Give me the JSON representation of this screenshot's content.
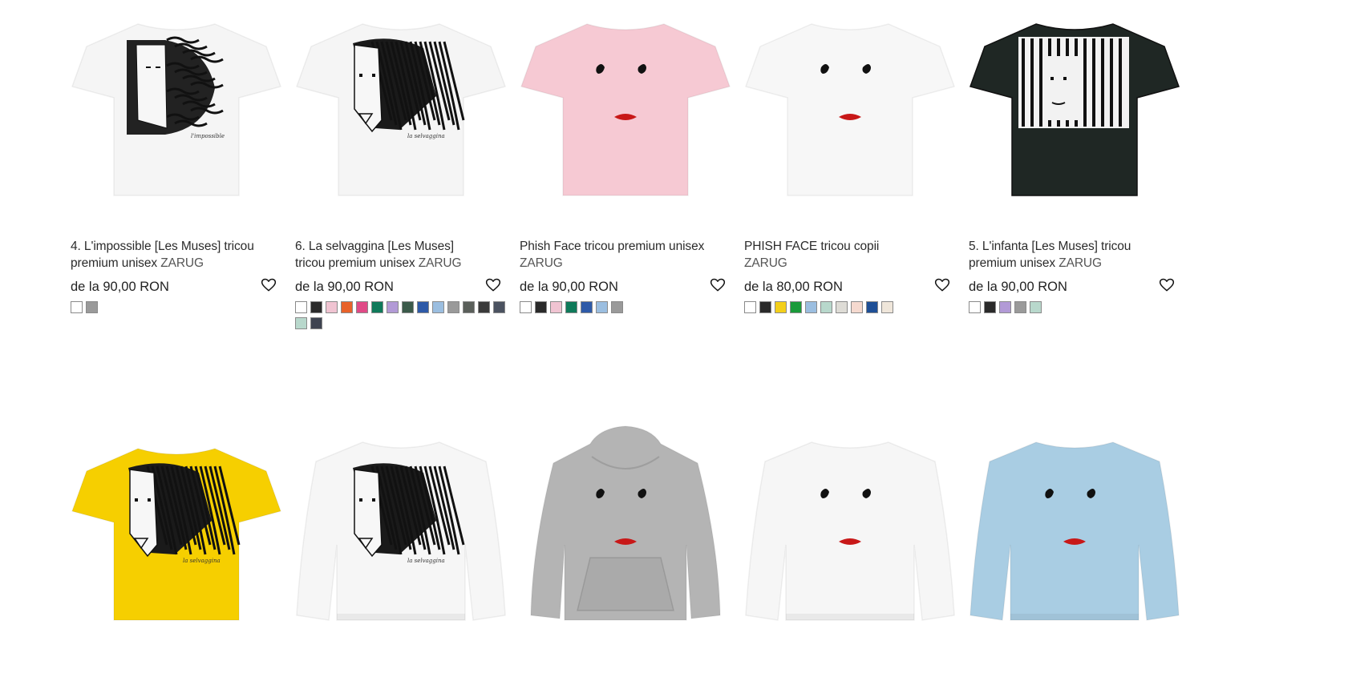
{
  "products": [
    {
      "title": "4. L'impossible [Les Muses] tricou premium unisex",
      "brand": "ZARUG",
      "price": "de la 90,00 RON",
      "garment": "tshirt",
      "color": "#f5f5f5",
      "design": "curly",
      "swatches": [
        "#ffffff",
        "#9a9a9a"
      ]
    },
    {
      "title": "6. La selvaggina [Les Muses] tricou premium unisex",
      "brand": "ZARUG",
      "price": "de la 90,00 RON",
      "garment": "tshirt",
      "color": "#f5f5f5",
      "design": "straight",
      "swatches": [
        "#ffffff",
        "#2a2a2a",
        "#f0c4d2",
        "#e8622a",
        "#e04a86",
        "#0f7a5a",
        "#b29ad6",
        "#3b5a4a",
        "#2e5aa8",
        "#9bbee0",
        "#9a9a9a",
        "#5a5f5a",
        "#3a3a3a",
        "#4b5260",
        "#b8d8cc",
        "#3e4350"
      ]
    },
    {
      "title": "Phish Face tricou premium unisex",
      "brand": "ZARUG",
      "price": "de la 90,00 RON",
      "garment": "tshirt",
      "color": "#f6c9d3",
      "design": "face",
      "swatches": [
        "#ffffff",
        "#2a2a2a",
        "#f0c4d2",
        "#0f7a5a",
        "#2e5aa8",
        "#9bbee0",
        "#9a9a9a"
      ]
    },
    {
      "title": "PHISH FACE tricou copii",
      "brand": "ZARUG",
      "price": "de la 80,00 RON",
      "garment": "tshirt",
      "color": "#f7f7f7",
      "design": "face",
      "swatches": [
        "#ffffff",
        "#2a2a2a",
        "#f3cf1a",
        "#1a9a3a",
        "#9bbee0",
        "#b8d8cc",
        "#dedcd6",
        "#f5d9cf",
        "#1e4f96",
        "#efe6da"
      ]
    },
    {
      "title": "5. L'infanta [Les Muses] tricou premium unisex",
      "brand": "ZARUG",
      "price": "de la 90,00 RON",
      "garment": "tshirt",
      "color": "#1f2724",
      "design": "infanta",
      "swatches": [
        "#ffffff",
        "#2a2a2a",
        "#b29ad6",
        "#9a9a9a",
        "#b8d8cc"
      ]
    },
    {
      "garment": "tshirt",
      "color": "#f6cf00",
      "design": "straight"
    },
    {
      "garment": "sweatshirt",
      "color": "#f6f6f6",
      "design": "straight"
    },
    {
      "garment": "hoodie",
      "color": "#b4b4b4",
      "design": "face"
    },
    {
      "garment": "sweatshirt",
      "color": "#f6f6f6",
      "design": "face"
    },
    {
      "garment": "sweatshirt",
      "color": "#a9cde3",
      "design": "face"
    }
  ],
  "icons": {
    "heart": "heart-outline-icon"
  }
}
